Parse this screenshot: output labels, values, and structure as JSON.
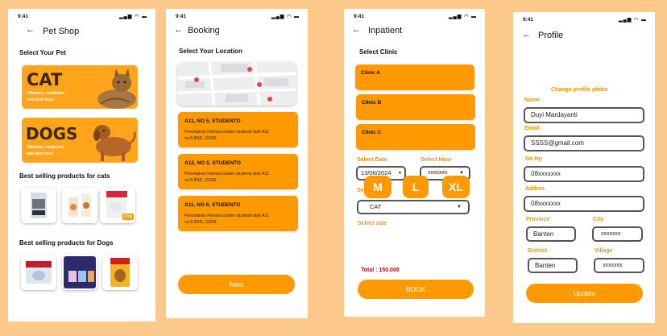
{
  "colors": {
    "background": "#FDC98B",
    "accent": "#FF9900",
    "field_border": "#555555"
  },
  "status": {
    "time": "9:41"
  },
  "pet_shop": {
    "title": "Pet Shop",
    "select_label": "Select Your Pet",
    "cat_banner": {
      "title": "CAT",
      "subtitle_line1": "Vitamins, medicine,",
      "subtitle_line2": "and also food"
    },
    "dogs_banner": {
      "title": "DOGS",
      "subtitle_line1": "Vitamins, medicine,",
      "subtitle_line2": "and also food"
    },
    "cats_section": "Best selling products for cats",
    "dogs_section": "Best selling products for Dogs",
    "cat_products_badge": "2 kg"
  },
  "booking": {
    "title": "Booking",
    "section": "Select Your Location",
    "locations": [
      {
        "name": "A11, NO 5, STUDENTO",
        "address_line1": "Perumahan Foresta cluster studento blok A11",
        "address_line2": "no 5 BSD, 15339"
      },
      {
        "name": "A12, NO 5, STUDENTO",
        "address_line1": "Perumahan Foresta cluster studento blok A11",
        "address_line2": "no 5 BSD, 15339"
      },
      {
        "name": "A11, NO 6, STUDENTO",
        "address_line1": "Perumahan Foresta cluster studento blok A11",
        "address_line2": "no 6 BSD, 15339"
      }
    ],
    "next_label": "Next"
  },
  "inpatient": {
    "title": "Inpatient",
    "section": "Select Clinic",
    "clinics": [
      "Clinic A",
      "Clinic B",
      "Clinic C"
    ],
    "date_label": "Select Date",
    "date_value": "13/06/2024",
    "hour_label": "Select Hour",
    "hour_value": "xxxxxxx",
    "pet_label": "Se",
    "pet_value": "CAT",
    "size_label": "Select size",
    "sizes": [
      "M",
      "L",
      "XL"
    ],
    "total": "Total : 150.000",
    "book_label": "BOOK"
  },
  "profile": {
    "title": "Profile",
    "change_photo": "Change profile photo",
    "name_label": "Name",
    "name_value": "Duyi Mardayanti",
    "email_label": "Email",
    "email_value": "SSSS@gmail.com",
    "phone_label": "No Hp",
    "phone_value": "08xxxxxxx",
    "address_label": "Addres",
    "address_value": "08xxxxxxx",
    "province_label": "Province",
    "province_value": "Banten",
    "city_label": "City",
    "city_value": "xxxxxxx",
    "district_label": "District",
    "district_value": "Banten",
    "village_label": "Village",
    "village_value": "xxxxxxx",
    "update_label": "Update"
  }
}
